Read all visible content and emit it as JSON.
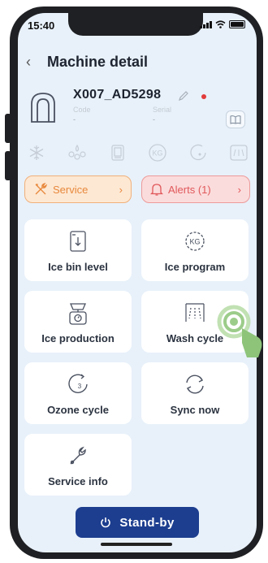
{
  "status_bar": {
    "time": "15:40"
  },
  "header": {
    "title": "Machine detail",
    "back_icon": "chevron-left-icon"
  },
  "machine": {
    "name": "X007_AD5298",
    "code_label": "Code",
    "code_value": "-",
    "serial_label": "Serial",
    "serial_value": "-",
    "status_dot_color": "#e23b3b"
  },
  "feature_icons": [
    "snowflake-icon",
    "water-drops-icon",
    "filter-icon",
    "kg-icon",
    "ozone-icon",
    "wash-icon"
  ],
  "service_pill": {
    "label": "Service",
    "chevron": "›"
  },
  "alerts_pill": {
    "label": "Alerts (1)",
    "chevron": "›"
  },
  "tiles": [
    {
      "label": "Ice bin level",
      "icon": "ice-bin-icon"
    },
    {
      "label": "Ice program",
      "icon": "kg-program-icon"
    },
    {
      "label": "Ice production",
      "icon": "scale-icon"
    },
    {
      "label": "Wash cycle",
      "icon": "shower-icon"
    },
    {
      "label": "Ozone cycle",
      "icon": "ozone-cycle-icon"
    },
    {
      "label": "Sync now",
      "icon": "sync-icon"
    },
    {
      "label": "Service info",
      "icon": "wrench-icon"
    }
  ],
  "standby_button": {
    "label": "Stand-by",
    "icon": "power-icon"
  },
  "colors": {
    "background": "#e8f1fa",
    "accent": "#1d3e8f",
    "service": "#e8883c",
    "alert": "#e0585b",
    "touch": "#9ccc8a"
  }
}
